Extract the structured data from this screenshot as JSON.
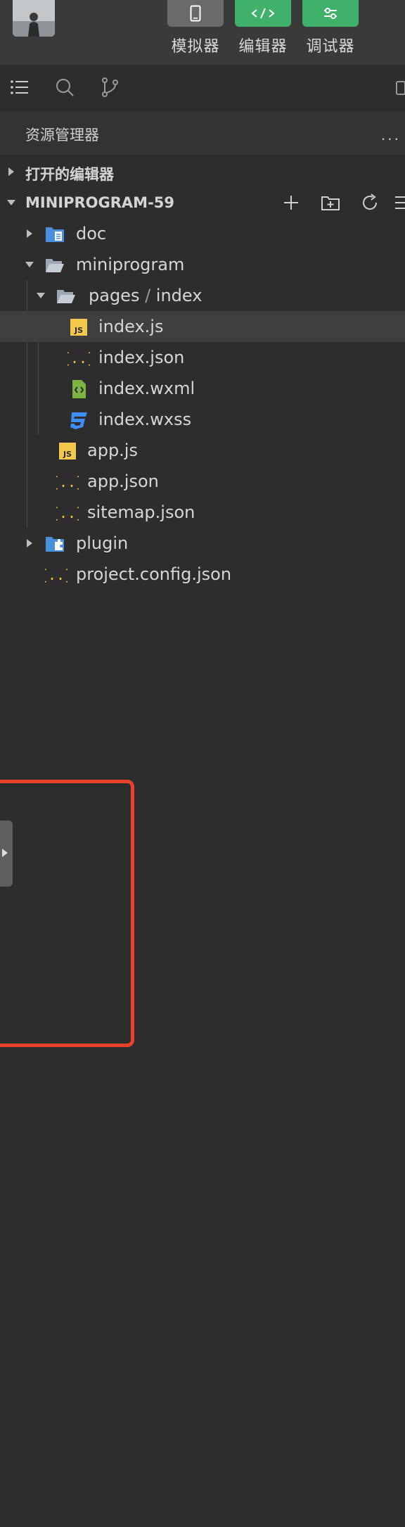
{
  "toolbar": {
    "simulator_label": "模拟器",
    "editor_label": "编辑器",
    "debugger_label": "调试器"
  },
  "explorer": {
    "title": "资源管理器",
    "more": "···"
  },
  "sections": {
    "open_editors": "打开的编辑器",
    "project": "MINIPROGRAM-59"
  },
  "tree": {
    "doc": "doc",
    "miniprogram": "miniprogram",
    "pages_folder": "pages",
    "pages_sep": " / ",
    "pages_sub": "index",
    "index_js": "index.js",
    "index_json": "index.json",
    "index_wxml": "index.wxml",
    "index_wxss": "index.wxss",
    "app_js": "app.js",
    "app_json": "app.json",
    "sitemap_json": "sitemap.json",
    "plugin": "plugin",
    "project_config": "project.config.json"
  },
  "colors": {
    "accent_green": "#3fb16a",
    "highlight_red": "#e8412c",
    "js_yellow": "#f2c94c",
    "json_yellow": "#f0c040",
    "wxml_green": "#7cb342",
    "wxss_blue": "#3e8ef7",
    "folder_blue": "#4a8fdd"
  }
}
